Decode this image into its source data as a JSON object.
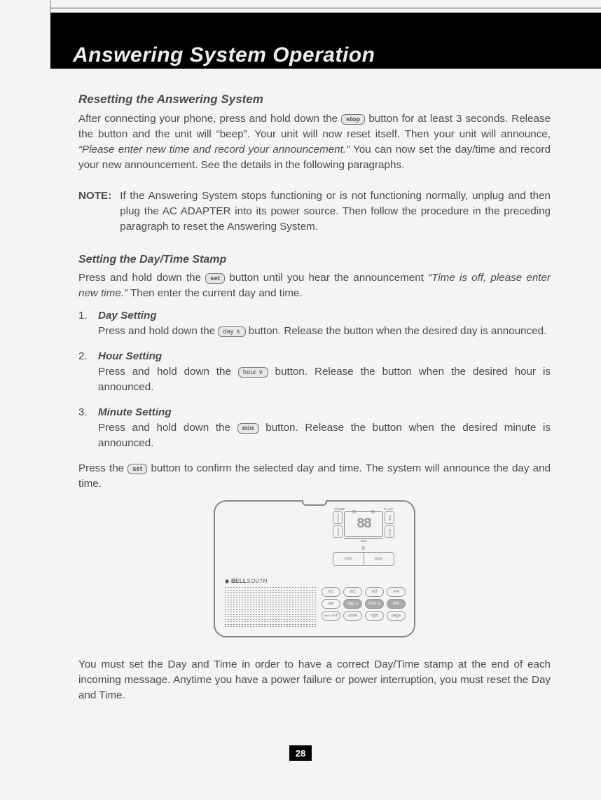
{
  "chapter_title": "Answering System Operation",
  "page_number": "28",
  "section1": {
    "heading": "Resetting the Answering System",
    "p1_a": "After connecting your phone, press and hold down the ",
    "p1_b": " button for at least 3 seconds. Release the button and the unit will “beep”. Your unit will now reset itself. Then your unit will announce, ",
    "quote": "“Please enter new time and record your announcement.”",
    "p1_c": " You can now set the day/time and record your new announcement. See the details in the following paragraphs."
  },
  "btn_stop": "stop",
  "btn_set": "set",
  "btn_day": "day ∧",
  "btn_hour": "hour ∨",
  "btn_min": "min",
  "note": {
    "label": "NOTE:",
    "text": "If the Answering System stops functioning or is not functioning normally, unplug and then plug the AC ADAPTER into its power source. Then follow the procedure in the preceding paragraph to reset the Answering System."
  },
  "section2": {
    "heading": "Setting the Day/Time Stamp",
    "p_a": "Press and hold down the ",
    "p_b": " button until you hear the announcement ",
    "quote": "“Time is off, please enter new time.”",
    "p_c": " Then enter the current day and time."
  },
  "steps": [
    {
      "num": "1.",
      "title": "Day Setting",
      "a": "Press and hold down the ",
      "btn": "btn_day",
      "b": " button. Release the button when the desired day is announced."
    },
    {
      "num": "2.",
      "title": "Hour Setting",
      "a": "Press and hold down the ",
      "btn": "btn_hour",
      "b": " button. Release the button when the desired hour is announced."
    },
    {
      "num": "3.",
      "title": "Minute Setting",
      "a": "Press and hold down the ",
      "btn": "btn_min",
      "b": " button. Release the button when the desired minute is announced."
    }
  ],
  "confirm": {
    "a": "Press the ",
    "b": " button to confirm the selected day and time. The system will announce the day and time."
  },
  "closing": "You must set the Day and Time in order to have a correct Day/Time stamp at the end of each incoming message. Anytime you have a power failure or power interruption, you must reset the Day and Time.",
  "device": {
    "brand_bold": "BELL",
    "brand_thin": "SOUTH",
    "digits": "88",
    "lbl_charge": "charge",
    "lbl_inuse": "in use",
    "side_memo": "memo",
    "side_annc": "annce",
    "side_stop": "stop",
    "side_repeat": "repeat",
    "skip": "skip",
    "spkr": "spkr",
    "play": "play",
    "grid": [
      "m1",
      "m2",
      "m3",
      "m4",
      "set",
      "day ∧",
      "hour ∨",
      "min",
      "ans on/off",
      "code",
      "ogm",
      "page"
    ]
  }
}
